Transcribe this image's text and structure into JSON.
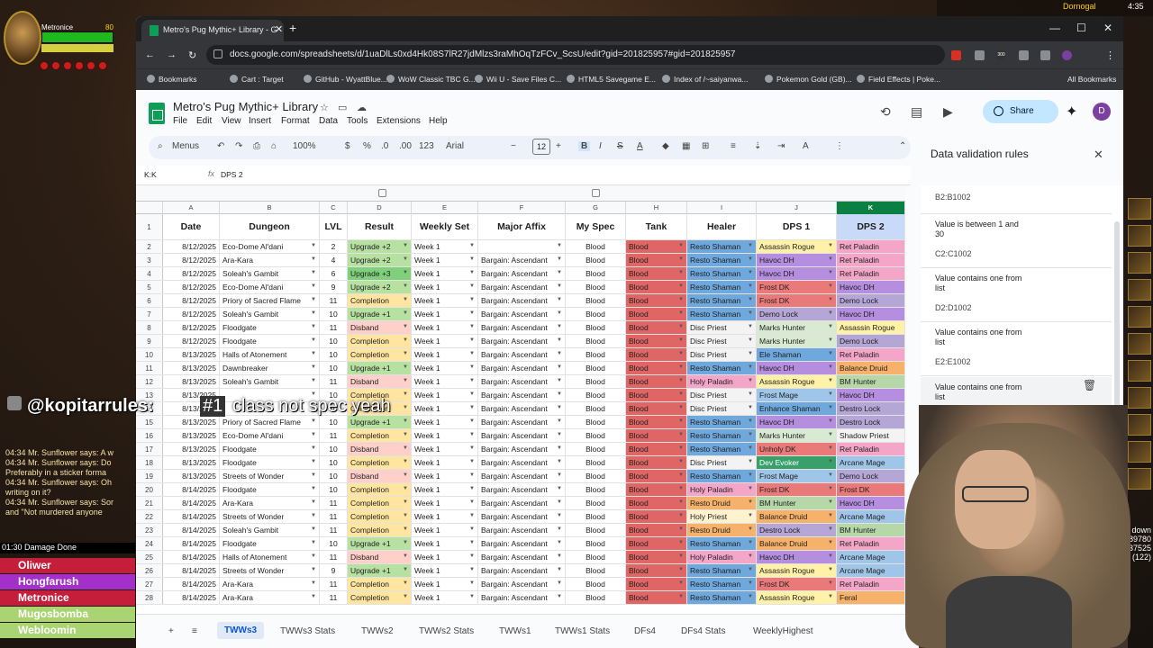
{
  "game": {
    "player_name": "Metronice",
    "player_level": "80",
    "top_right_name": "Dornogal",
    "clock": "4:35",
    "chat_user": "@kopitarrules:",
    "chat_badge": "#1",
    "chat_text": "class not spec yeah",
    "chat_log": [
      "04:34 Mr. Sunflower says: A w",
      "04:34 Mr. Sunflower says: Do",
      "Preferably in a sticker forma",
      "04:34 Mr. Sunflower says: Oh",
      "writing on it?",
      "04:34 Mr. Sunflower says: Sor",
      "and \"Not murdered anyone"
    ],
    "damage_title": "01:30 Damage Done",
    "damage_rows": [
      {
        "name": "Oliwer",
        "color": "#c41e3a"
      },
      {
        "name": "Hongfarush",
        "color": "#a330c9"
      },
      {
        "name": "Metronice",
        "color": "#c41e3a"
      },
      {
        "name": "Mugosbomba",
        "color": "#aad372"
      },
      {
        "name": "Webloomin",
        "color": "#aad372"
      }
    ],
    "minimap_text": [
      "down",
      "89780",
      "37525",
      "(122)"
    ]
  },
  "browser": {
    "tab_title": "Metro's Pug Mythic+ Library - G",
    "url": "docs.google.com/spreadsheets/d/1uaDlLs0xd4Hk08S7lR27jdMlzs3raMhOqTzFCv_ScsU/edit?gid=201825957#gid=201825957",
    "bookmarks": [
      "Bookmarks",
      "Cart : Target",
      "GitHub - WyattBlue...",
      "WoW Classic TBC G...",
      "Wii U - Save Files C...",
      "HTML5 Savegame E...",
      "Index of /~saiyanwa...",
      "Pokemon Gold (GB)...",
      "Field Effects | Poke..."
    ],
    "all_bookmarks": "All Bookmarks",
    "ext_badge": "300"
  },
  "sheets": {
    "doc_title": "Metro's Pug Mythic+ Library",
    "menus": [
      "File",
      "Edit",
      "View",
      "Insert",
      "Format",
      "Data",
      "Tools",
      "Extensions",
      "Help"
    ],
    "share_label": "Share",
    "avatar_letter": "D",
    "toolbar": {
      "search": "Menus",
      "zoom": "100%",
      "currency": "$",
      "percent": "%",
      "dec_less": ".0",
      "dec_more": ".00",
      "number_format": "123",
      "font": "Arial",
      "font_size": "12",
      "bold": "B",
      "italic": "I",
      "strike": "S",
      "text_color": "A"
    },
    "name_box": "K:K",
    "fx": "fx",
    "formula_value": "DPS 2",
    "column_letters": [
      "A",
      "B",
      "C",
      "D",
      "E",
      "F",
      "G",
      "H",
      "I",
      "J",
      "K"
    ],
    "headers": [
      "Date",
      "Dungeon",
      "LVL",
      "Result",
      "Weekly Set",
      "Major Affix",
      "My Spec",
      "Tank",
      "Healer",
      "DPS 1",
      "DPS 2"
    ],
    "rows": [
      {
        "n": "2",
        "date": "8/12/2025",
        "dungeon": "Eco-Dome Al'dani",
        "lvl": "2",
        "result": "Upgrade +2",
        "week": "Week 1",
        "affix": "",
        "spec": "Blood",
        "tank": "Blood",
        "healer": "Resto Shaman",
        "dps1": "Assassin Rogue",
        "dps2": "Ret Paladin"
      },
      {
        "n": "3",
        "date": "8/12/2025",
        "dungeon": "Ara-Kara",
        "lvl": "4",
        "result": "Upgrade +2",
        "week": "Week 1",
        "affix": "Bargain: Ascendant",
        "spec": "Blood",
        "tank": "Blood",
        "healer": "Resto Shaman",
        "dps1": "Havoc DH",
        "dps2": "Ret Paladin"
      },
      {
        "n": "4",
        "date": "8/12/2025",
        "dungeon": "Soleah's Gambit",
        "lvl": "6",
        "result": "Upgrade +3",
        "week": "Week 1",
        "affix": "Bargain: Ascendant",
        "spec": "Blood",
        "tank": "Blood",
        "healer": "Resto Shaman",
        "dps1": "Havoc DH",
        "dps2": "Ret Paladin"
      },
      {
        "n": "5",
        "date": "8/12/2025",
        "dungeon": "Eco-Dome Al'dani",
        "lvl": "9",
        "result": "Upgrade +2",
        "week": "Week 1",
        "affix": "Bargain: Ascendant",
        "spec": "Blood",
        "tank": "Blood",
        "healer": "Resto Shaman",
        "dps1": "Frost DK",
        "dps2": "Havoc DH"
      },
      {
        "n": "6",
        "date": "8/12/2025",
        "dungeon": "Priory of Sacred Flame",
        "lvl": "11",
        "result": "Completion",
        "week": "Week 1",
        "affix": "Bargain: Ascendant",
        "spec": "Blood",
        "tank": "Blood",
        "healer": "Resto Shaman",
        "dps1": "Frost DK",
        "dps2": "Demo Lock"
      },
      {
        "n": "7",
        "date": "8/12/2025",
        "dungeon": "Soleah's Gambit",
        "lvl": "10",
        "result": "Upgrade +1",
        "week": "Week 1",
        "affix": "Bargain: Ascendant",
        "spec": "Blood",
        "tank": "Blood",
        "healer": "Resto Shaman",
        "dps1": "Demo Lock",
        "dps2": "Havoc DH"
      },
      {
        "n": "8",
        "date": "8/12/2025",
        "dungeon": "Floodgate",
        "lvl": "11",
        "result": "Disband",
        "week": "Week 1",
        "affix": "Bargain: Ascendant",
        "spec": "Blood",
        "tank": "Blood",
        "healer": "Disc Priest",
        "dps1": "Marks Hunter",
        "dps2": "Assassin Rogue"
      },
      {
        "n": "9",
        "date": "8/12/2025",
        "dungeon": "Floodgate",
        "lvl": "10",
        "result": "Completion",
        "week": "Week 1",
        "affix": "Bargain: Ascendant",
        "spec": "Blood",
        "tank": "Blood",
        "healer": "Disc Priest",
        "dps1": "Marks Hunter",
        "dps2": "Demo Lock"
      },
      {
        "n": "10",
        "date": "8/13/2025",
        "dungeon": "Halls of Atonement",
        "lvl": "10",
        "result": "Completion",
        "week": "Week 1",
        "affix": "Bargain: Ascendant",
        "spec": "Blood",
        "tank": "Blood",
        "healer": "Disc Priest",
        "dps1": "Ele Shaman",
        "dps2": "Ret Paladin"
      },
      {
        "n": "11",
        "date": "8/13/2025",
        "dungeon": "Dawnbreaker",
        "lvl": "10",
        "result": "Upgrade +1",
        "week": "Week 1",
        "affix": "Bargain: Ascendant",
        "spec": "Blood",
        "tank": "Blood",
        "healer": "Resto Shaman",
        "dps1": "Havoc DH",
        "dps2": "Balance Druid"
      },
      {
        "n": "12",
        "date": "8/13/2025",
        "dungeon": "Soleah's Gambit",
        "lvl": "11",
        "result": "Disband",
        "week": "Week 1",
        "affix": "Bargain: Ascendant",
        "spec": "Blood",
        "tank": "Blood",
        "healer": "Holy Paladin",
        "dps1": "Assassin Rogue",
        "dps2": "BM Hunter"
      },
      {
        "n": "13",
        "date": "8/13/2025",
        "dungeon": "",
        "lvl": "10",
        "result": "Completion",
        "week": "Week 1",
        "affix": "Bargain: Ascendant",
        "spec": "Blood",
        "tank": "Blood",
        "healer": "Disc Priest",
        "dps1": "Frost Mage",
        "dps2": "Havoc DH"
      },
      {
        "n": "14",
        "date": "8/13/2025",
        "dungeon": "",
        "lvl": "10",
        "result": "Completion",
        "week": "Week 1",
        "affix": "Bargain: Ascendant",
        "spec": "Blood",
        "tank": "Blood",
        "healer": "Disc Priest",
        "dps1": "Enhance Shaman",
        "dps2": "Destro Lock"
      },
      {
        "n": "15",
        "date": "8/13/2025",
        "dungeon": "Priory of Sacred Flame",
        "lvl": "10",
        "result": "Upgrade +1",
        "week": "Week 1",
        "affix": "Bargain: Ascendant",
        "spec": "Blood",
        "tank": "Blood",
        "healer": "Resto Shaman",
        "dps1": "Havoc DH",
        "dps2": "Destro Lock"
      },
      {
        "n": "16",
        "date": "8/13/2025",
        "dungeon": "Eco-Dome Al'dani",
        "lvl": "11",
        "result": "Completion",
        "week": "Week 1",
        "affix": "Bargain: Ascendant",
        "spec": "Blood",
        "tank": "Blood",
        "healer": "Resto Shaman",
        "dps1": "Marks Hunter",
        "dps2": "Shadow Priest"
      },
      {
        "n": "17",
        "date": "8/13/2025",
        "dungeon": "Floodgate",
        "lvl": "10",
        "result": "Disband",
        "week": "Week 1",
        "affix": "Bargain: Ascendant",
        "spec": "Blood",
        "tank": "Blood",
        "healer": "Resto Shaman",
        "dps1": "Unholy DK",
        "dps2": "Ret Paladin"
      },
      {
        "n": "18",
        "date": "8/13/2025",
        "dungeon": "Floodgate",
        "lvl": "10",
        "result": "Completion",
        "week": "Week 1",
        "affix": "Bargain: Ascendant",
        "spec": "Blood",
        "tank": "Blood",
        "healer": "Disc Priest",
        "dps1": "Dev Evoker",
        "dps2": "Arcane Mage"
      },
      {
        "n": "19",
        "date": "8/13/2025",
        "dungeon": "Streets of Wonder",
        "lvl": "10",
        "result": "Disband",
        "week": "Week 1",
        "affix": "Bargain: Ascendant",
        "spec": "Blood",
        "tank": "Blood",
        "healer": "Resto Shaman",
        "dps1": "Frost Mage",
        "dps2": "Demo Lock"
      },
      {
        "n": "20",
        "date": "8/14/2025",
        "dungeon": "Floodgate",
        "lvl": "10",
        "result": "Completion",
        "week": "Week 1",
        "affix": "Bargain: Ascendant",
        "spec": "Blood",
        "tank": "Blood",
        "healer": "Holy Paladin",
        "dps1": "Frost DK",
        "dps2": "Frost DK"
      },
      {
        "n": "21",
        "date": "8/14/2025",
        "dungeon": "Ara-Kara",
        "lvl": "11",
        "result": "Completion",
        "week": "Week 1",
        "affix": "Bargain: Ascendant",
        "spec": "Blood",
        "tank": "Blood",
        "healer": "Resto Druid",
        "dps1": "BM Hunter",
        "dps2": "Havoc DH"
      },
      {
        "n": "22",
        "date": "8/14/2025",
        "dungeon": "Streets of Wonder",
        "lvl": "11",
        "result": "Completion",
        "week": "Week 1",
        "affix": "Bargain: Ascendant",
        "spec": "Blood",
        "tank": "Blood",
        "healer": "Holy Priest",
        "dps1": "Balance Druid",
        "dps2": "Arcane Mage"
      },
      {
        "n": "23",
        "date": "8/14/2025",
        "dungeon": "Soleah's Gambit",
        "lvl": "11",
        "result": "Completion",
        "week": "Week 1",
        "affix": "Bargain: Ascendant",
        "spec": "Blood",
        "tank": "Blood",
        "healer": "Resto Druid",
        "dps1": "Destro Lock",
        "dps2": "BM Hunter"
      },
      {
        "n": "24",
        "date": "8/14/2025",
        "dungeon": "Floodgate",
        "lvl": "10",
        "result": "Upgrade +1",
        "week": "Week 1",
        "affix": "Bargain: Ascendant",
        "spec": "Blood",
        "tank": "Blood",
        "healer": "Resto Shaman",
        "dps1": "Balance Druid",
        "dps2": "Ret Paladin"
      },
      {
        "n": "25",
        "date": "8/14/2025",
        "dungeon": "Halls of Atonement",
        "lvl": "11",
        "result": "Disband",
        "week": "Week 1",
        "affix": "Bargain: Ascendant",
        "spec": "Blood",
        "tank": "Blood",
        "healer": "Holy Paladin",
        "dps1": "Havoc DH",
        "dps2": "Arcane Mage"
      },
      {
        "n": "26",
        "date": "8/14/2025",
        "dungeon": "Streets of Wonder",
        "lvl": "9",
        "result": "Upgrade +1",
        "week": "Week 1",
        "affix": "Bargain: Ascendant",
        "spec": "Blood",
        "tank": "Blood",
        "healer": "Resto Shaman",
        "dps1": "Assassin Rogue",
        "dps2": "Arcane Mage"
      },
      {
        "n": "27",
        "date": "8/14/2025",
        "dungeon": "Ara-Kara",
        "lvl": "11",
        "result": "Completion",
        "week": "Week 1",
        "affix": "Bargain: Ascendant",
        "spec": "Blood",
        "tank": "Blood",
        "healer": "Resto Shaman",
        "dps1": "Frost DK",
        "dps2": "Ret Paladin"
      },
      {
        "n": "28",
        "date": "8/14/2025",
        "dungeon": "Ara-Kara",
        "lvl": "11",
        "result": "Completion",
        "week": "Week 1",
        "affix": "Bargain: Ascendant",
        "spec": "Blood",
        "tank": "Blood",
        "healer": "Resto Shaman",
        "dps1": "Assassin Rogue",
        "dps2": "Feral"
      }
    ],
    "sheet_tabs": [
      "TWWs3",
      "TWWs3 Stats",
      "TWWs2",
      "TWWs2 Stats",
      "TWWs1",
      "TWWs1 Stats",
      "DFs4",
      "DFs4 Stats",
      "WeeklyHighest"
    ],
    "active_tab": "TWWs3",
    "panel": {
      "title": "Data validation rules",
      "rules": [
        {
          "cond": "",
          "range": "B2:B1002"
        },
        {
          "cond": "Value is between 1 and 30",
          "range": "C2:C1002"
        },
        {
          "cond": "Value contains one from list",
          "range": "D2:D1002"
        },
        {
          "cond": "Value contains one from list",
          "range": "E2:E1002"
        },
        {
          "cond": "Value contains one from list",
          "range": "F2:F1002"
        }
      ],
      "partial_rule": "Va",
      "add_rule_partial": "rule"
    },
    "colors": {
      "result": {
        "Upgrade +1": "#b7e1a1",
        "Upgrade +2": "#b7e1a1",
        "Upgrade +3": "#7ed17a",
        "Completion": "#ffe5a0",
        "Disband": "#ffcfc9"
      },
      "blood": "#e06666",
      "class": {
        "Resto Shaman": "#6fa8dc",
        "Disc Priest": "#f3f3f3",
        "Holy Paladin": "#f4a6c8",
        "Resto Druid": "#f6b26b",
        "Holy Priest": "#fff2cc",
        "Assassin Rogue": "#fff2a8",
        "Havoc DH": "#b58ee0",
        "Frost DK": "#ea7a7a",
        "Demo Lock": "#b4a7d6",
        "Marks Hunter": "#d9ead3",
        "Ele Shaman": "#6fa8dc",
        "Frost Mage": "#9fc5e8",
        "Enhance Shaman": "#6fa8dc",
        "Unholy DK": "#ea7a7a",
        "Dev Evoker": "#38a169",
        "BM Hunter": "#b6d7a8",
        "Balance Druid": "#f6b26b",
        "Destro Lock": "#b4a7d6",
        "Ret Paladin": "#f4a6c8",
        "Arcane Mage": "#9fc5e8",
        "Shadow Priest": "#f3f3f3",
        "Feral": "#f6b26b"
      }
    }
  }
}
